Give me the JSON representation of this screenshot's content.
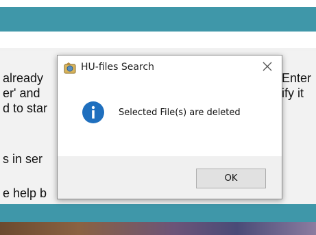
{
  "background": {
    "lines": [
      "already",
      "Enter",
      "er' and",
      "ify it",
      "d to star",
      "s in ser",
      "e help b"
    ]
  },
  "dialog": {
    "title": "HU-files Search",
    "message": "Selected File(s) are deleted",
    "ok_label": "OK",
    "icons": {
      "app": "hu-files-app-icon",
      "info": "info-icon",
      "close": "close-icon"
    },
    "colors": {
      "info_blue": "#1f6fbe",
      "accent_teal": "#3f97a9"
    }
  }
}
